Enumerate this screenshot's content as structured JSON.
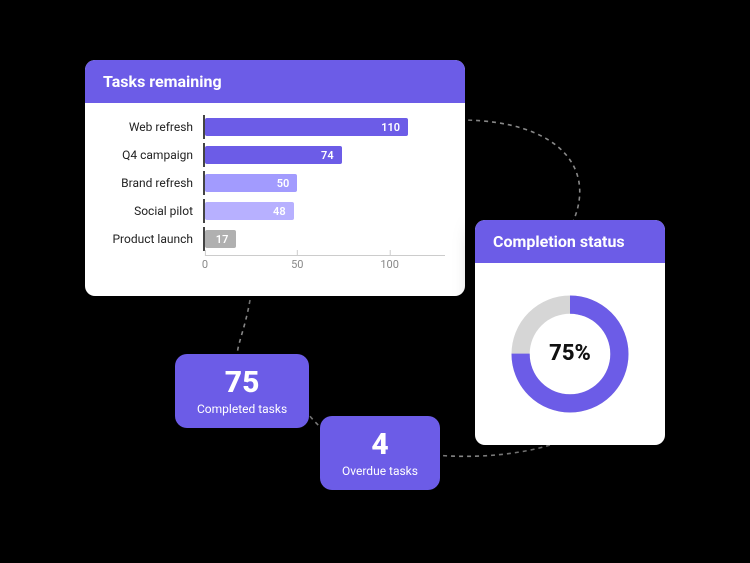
{
  "colors": {
    "accent": "#6c5ce7",
    "bar_shades": [
      "#6c5ce7",
      "#6c5ce7",
      "#a29bfe",
      "#b7b0ff",
      "#b0b0b0"
    ],
    "donut_track": "#d6d6d6"
  },
  "tasks_card": {
    "title": "Tasks remaining"
  },
  "status_card": {
    "title": "Completion status",
    "percent_label": "75%",
    "percent_value": 75
  },
  "chips": {
    "completed": {
      "value": "75",
      "label": "Completed tasks"
    },
    "overdue": {
      "value": "4",
      "label": "Overdue tasks"
    }
  },
  "axis_ticks": [
    "0",
    "50",
    "100"
  ],
  "chart_data": {
    "type": "bar",
    "title": "Tasks remaining",
    "xlabel": "",
    "ylabel": "",
    "xlim": [
      0,
      130
    ],
    "categories": [
      "Web refresh",
      "Q4 campaign",
      "Brand refresh",
      "Social pilot",
      "Product launch"
    ],
    "values": [
      110,
      74,
      50,
      48,
      17
    ]
  }
}
